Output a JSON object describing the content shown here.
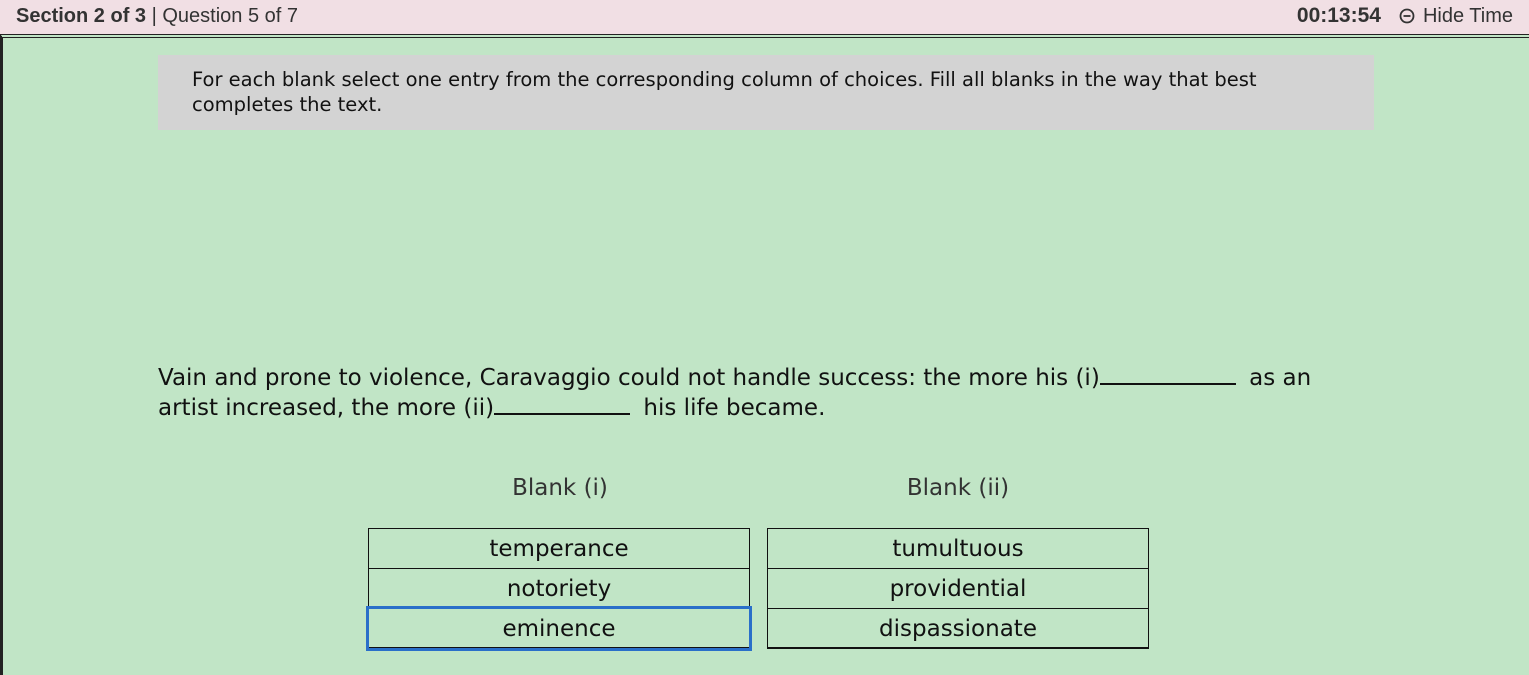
{
  "header": {
    "section_label": "Section 2 of 3",
    "separator": " | ",
    "question_label": "Question 5 of 7",
    "timer": "00:13:54",
    "hide_time_label": "Hide Time",
    "hide_time_icon": "minus-circle-icon"
  },
  "instructions": "For each blank select one entry from the corresponding column of choices. Fill all blanks in the way that best completes the text.",
  "question": {
    "part1": "Vain and prone to violence, Caravaggio could not handle success: the more his (i)",
    "part2": "as an artist increased, the more (ii)",
    "part3": "his life became."
  },
  "blanks": [
    {
      "heading": "Blank (i)",
      "choices": [
        "temperance",
        "notoriety",
        "eminence"
      ],
      "selected": "eminence"
    },
    {
      "heading": "Blank (ii)",
      "choices": [
        "tumultuous",
        "providential",
        "dispassionate"
      ],
      "selected": null
    }
  ],
  "colors": {
    "background": "#c1e5c6",
    "header_bg": "#f1dfe4",
    "instructions_bg": "#d3d3d3",
    "selection_outline": "#2a6fc9"
  }
}
